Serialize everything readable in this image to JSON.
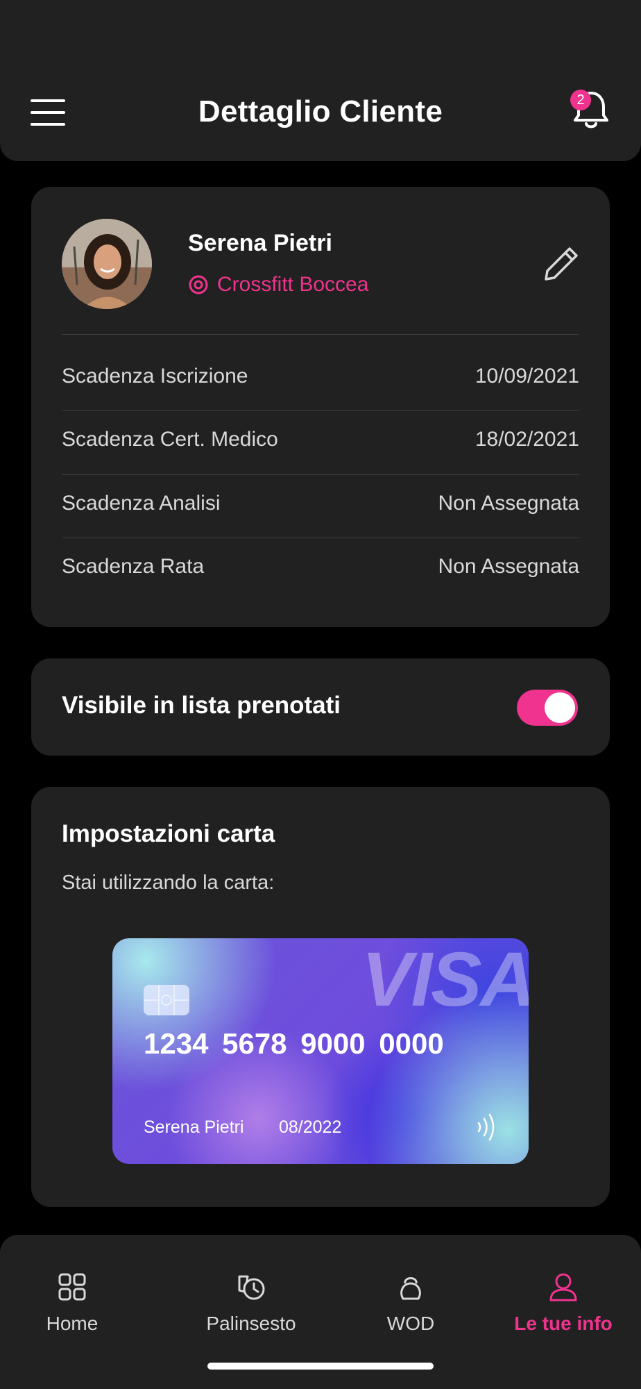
{
  "header": {
    "title": "Dettaglio Cliente",
    "notification_count": "2"
  },
  "profile": {
    "name": "Serena Pietri",
    "gym": "Crossfitt Boccea",
    "rows": [
      {
        "label": "Scadenza Iscrizione",
        "value": "10/09/2021"
      },
      {
        "label": "Scadenza Cert. Medico",
        "value": "18/02/2021"
      },
      {
        "label": "Scadenza Analisi",
        "value": "Non Assegnata"
      },
      {
        "label": "Scadenza Rata",
        "value": "Non Assegnata"
      }
    ]
  },
  "visibility": {
    "label": "Visibile in lista prenotati",
    "enabled": true
  },
  "card_settings": {
    "title": "Impostazioni carta",
    "subtitle": "Stai utilizzando la carta:",
    "card": {
      "brand": "VISA",
      "number": "1234  5678  9000  0000",
      "holder": "Serena Pietri",
      "expiry": "08/2022"
    }
  },
  "tabs": [
    {
      "label": "Home",
      "icon": "grid-icon",
      "active": false
    },
    {
      "label": "Palinsesto",
      "icon": "schedule-icon",
      "active": false
    },
    {
      "label": "WOD",
      "icon": "kettlebell-icon",
      "active": false
    },
    {
      "label": "Le tue info",
      "icon": "user-icon",
      "active": true
    }
  ],
  "colors": {
    "accent": "#f0338e",
    "background": "#000000",
    "surface": "#212121"
  }
}
